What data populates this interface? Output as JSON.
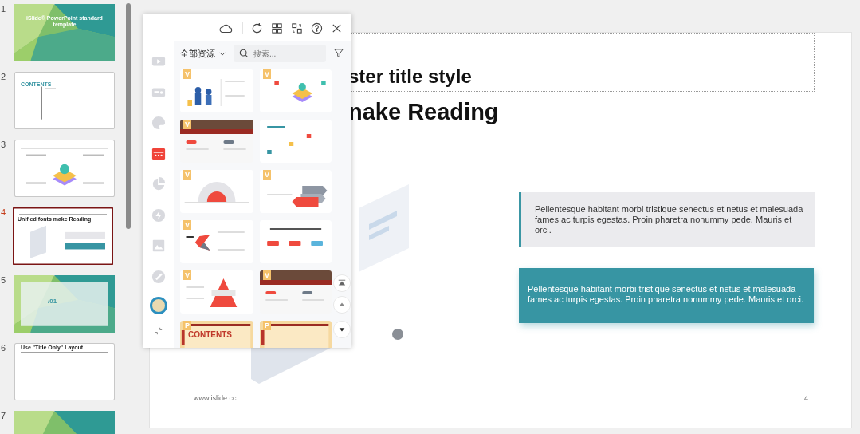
{
  "slides_pane": {
    "slides": [
      {
        "number": "1",
        "selected": false,
        "kind": "green",
        "caption": "iSlide® PowerPoint standard template"
      },
      {
        "number": "2",
        "selected": false,
        "kind": "contents",
        "caption": "CONTENTS"
      },
      {
        "number": "3",
        "selected": false,
        "kind": "flask"
      },
      {
        "number": "4",
        "selected": true,
        "kind": "current",
        "caption": "Unified fonts make Reading"
      },
      {
        "number": "5",
        "selected": false,
        "kind": "section",
        "caption": "/01"
      },
      {
        "number": "6",
        "selected": false,
        "kind": "title_only",
        "caption": "Use \"Title Only\" Layout"
      },
      {
        "number": "7",
        "selected": false,
        "kind": "green"
      }
    ]
  },
  "slide": {
    "title_line_1": "ster title style",
    "title_line_2": "nake Reading",
    "gray_box": "Pellentesque habitant morbi tristique senectus et netus et malesuada fames ac turpis egestas. Proin pharetra nonummy pede. Mauris et orci.",
    "teal_box": "Pellentesque habitant morbi tristique senectus et netus et malesuada fames ac turpis egestas. Proin pharetra nonummy pede. Mauris et orci.",
    "footer": "www.islide.cc",
    "page_number": "4"
  },
  "resource_panel": {
    "filter": "全部资源",
    "search": {
      "placeholder": "搜索..."
    },
    "rail": [
      {
        "kind": "video",
        "selected": false
      },
      {
        "kind": "card",
        "selected": false
      },
      {
        "kind": "palette",
        "selected": false
      },
      {
        "kind": "template",
        "selected": true
      },
      {
        "kind": "chart",
        "selected": false
      },
      {
        "kind": "bolt",
        "selected": false
      },
      {
        "kind": "image",
        "selected": false
      },
      {
        "kind": "brush",
        "selected": false
      }
    ],
    "tiles": [
      {
        "badge": "V",
        "kind": "people"
      },
      {
        "badge": "V",
        "kind": "flask"
      },
      {
        "badge": "V",
        "kind": "photo"
      },
      {
        "kind": "boxes"
      },
      {
        "badge": "V",
        "kind": "arc"
      },
      {
        "badge": "V",
        "kind": "arrows"
      },
      {
        "badge": "V",
        "kind": "chevron"
      },
      {
        "kind": "steps"
      },
      {
        "badge": "V",
        "kind": "pyramid"
      },
      {
        "badge": "V",
        "kind": "photo"
      },
      {
        "badge": "P",
        "kind": "contents",
        "title": "CONTENTS"
      },
      {
        "badge": "P",
        "kind": "contents"
      }
    ]
  }
}
